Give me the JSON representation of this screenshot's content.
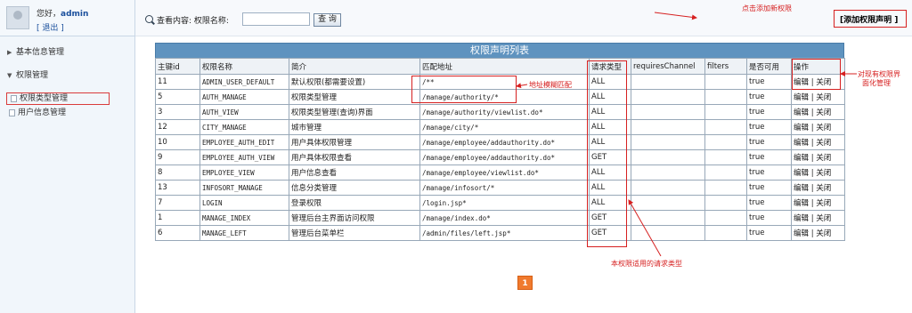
{
  "sidebar": {
    "greeting_prefix": "您好，",
    "username": "admin",
    "logout": "[ 退出 ]",
    "groups": [
      {
        "label": "基本信息管理",
        "expanded": false
      },
      {
        "label": "权限管理",
        "expanded": true
      }
    ],
    "items": [
      {
        "label": "权限类型管理",
        "active": true
      },
      {
        "label": "用户信息管理",
        "active": false
      }
    ]
  },
  "search": {
    "label": "查看内容: 权限名称:",
    "value": "",
    "button": "查 询"
  },
  "header_actions": {
    "add_link": "[添加权限声明 ]",
    "add_note": "点击添加新权限"
  },
  "table": {
    "title": "权限声明列表",
    "columns": [
      "主键id",
      "权限名称",
      "简介",
      "匹配地址",
      "请求类型",
      "requiresChannel",
      "filters",
      "是否可用",
      "操作"
    ],
    "rows": [
      {
        "id": "11",
        "name": "ADMIN_USER_DEFAULT",
        "desc": "默认权限(都需要设置)",
        "url": "/**",
        "method": "ALL",
        "channel": "",
        "filters": "",
        "enabled": "true",
        "edit": "编辑",
        "close": "关闭"
      },
      {
        "id": "5",
        "name": "AUTH_MANAGE",
        "desc": "权限类型管理",
        "url": "/manage/authority/*",
        "method": "ALL",
        "channel": "",
        "filters": "",
        "enabled": "true",
        "edit": "编辑",
        "close": "关闭"
      },
      {
        "id": "3",
        "name": "AUTH_VIEW",
        "desc": "权限类型管理(查询)界面",
        "url": "/manage/authority/viewlist.do*",
        "method": "ALL",
        "channel": "",
        "filters": "",
        "enabled": "true",
        "edit": "编辑",
        "close": "关闭"
      },
      {
        "id": "12",
        "name": "CITY_MANAGE",
        "desc": "城市管理",
        "url": "/manage/city/*",
        "method": "ALL",
        "channel": "",
        "filters": "",
        "enabled": "true",
        "edit": "编辑",
        "close": "关闭"
      },
      {
        "id": "10",
        "name": "EMPLOYEE_AUTH_EDIT",
        "desc": "用户具体权限管理",
        "url": "/manage/employee/addauthority.do*",
        "method": "ALL",
        "channel": "",
        "filters": "",
        "enabled": "true",
        "edit": "编辑",
        "close": "关闭"
      },
      {
        "id": "9",
        "name": "EMPLOYEE_AUTH_VIEW",
        "desc": "用户具体权限查看",
        "url": "/manage/employee/addauthority.do*",
        "method": "GET",
        "channel": "",
        "filters": "",
        "enabled": "true",
        "edit": "编辑",
        "close": "关闭"
      },
      {
        "id": "8",
        "name": "EMPLOYEE_VIEW",
        "desc": "用户信息查看",
        "url": "/manage/employee/viewlist.do*",
        "method": "ALL",
        "channel": "",
        "filters": "",
        "enabled": "true",
        "edit": "编辑",
        "close": "关闭"
      },
      {
        "id": "13",
        "name": "INFOSORT_MANAGE",
        "desc": "信息分类管理",
        "url": "/manage/infosort/*",
        "method": "ALL",
        "channel": "",
        "filters": "",
        "enabled": "true",
        "edit": "编辑",
        "close": "关闭"
      },
      {
        "id": "7",
        "name": "LOGIN",
        "desc": "登录权限",
        "url": "/login.jsp*",
        "method": "ALL",
        "channel": "",
        "filters": "",
        "enabled": "true",
        "edit": "编辑",
        "close": "关闭"
      },
      {
        "id": "1",
        "name": "MANAGE_INDEX",
        "desc": "管理后台主界面访问权限",
        "url": "/manage/index.do*",
        "method": "GET",
        "channel": "",
        "filters": "",
        "enabled": "true",
        "edit": "编辑",
        "close": "关闭"
      },
      {
        "id": "6",
        "name": "MANAGE_LEFT",
        "desc": "管理后台菜单栏",
        "url": "/admin/files/left.jsp*",
        "method": "GET",
        "channel": "",
        "filters": "",
        "enabled": "true",
        "edit": "编辑",
        "close": "关闭"
      }
    ]
  },
  "annotations": {
    "fuzzy_match": "地址模糊匹配",
    "request_type": "本权限适用的请求类型",
    "ops_line1": "对现有权限界",
    "ops_line2": "面化管理"
  },
  "pager": {
    "current": "1"
  },
  "colors": {
    "annotation": "#d62020",
    "table_title": "#5f93bf",
    "pager": "#f07a2e",
    "link": "#1a4f9c"
  }
}
